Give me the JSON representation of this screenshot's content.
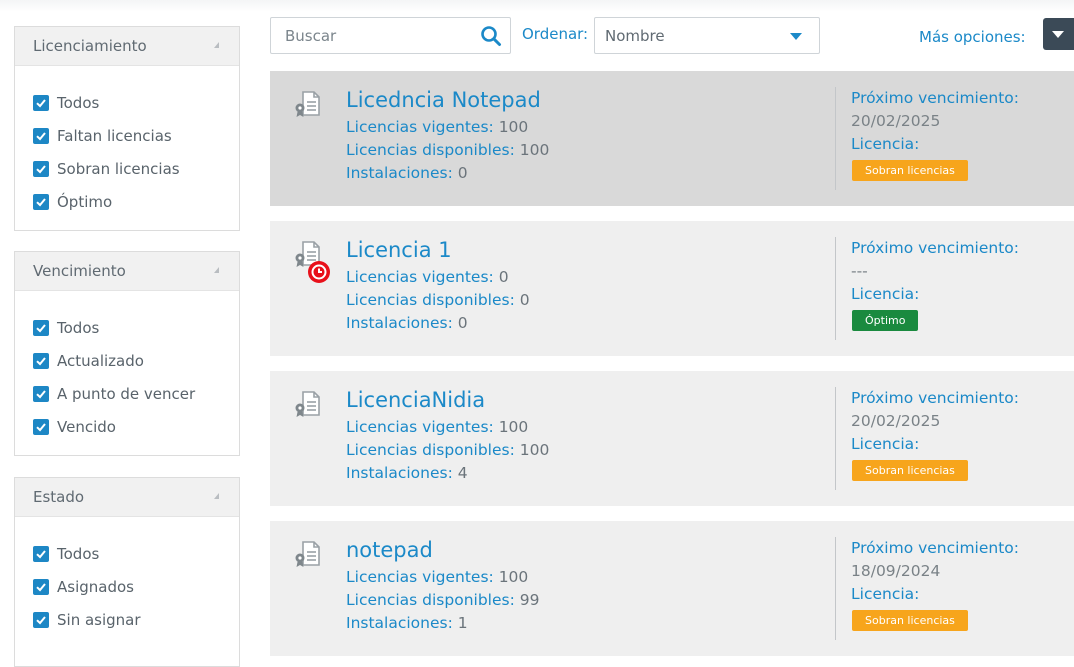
{
  "filters": [
    {
      "title": "Licenciamiento",
      "options": [
        "Todos",
        "Faltan licencias",
        "Sobran licencias",
        "Óptimo"
      ]
    },
    {
      "title": "Vencimiento",
      "options": [
        "Todos",
        "Actualizado",
        "A punto de vencer",
        "Vencido"
      ]
    },
    {
      "title": "Estado",
      "options": [
        "Todos",
        "Asignados",
        "Sin asignar"
      ]
    }
  ],
  "toolbar": {
    "search_placeholder": "Buscar",
    "order_label": "Ordenar:",
    "order_value": "Nombre",
    "more_options_label": "Más opciones:"
  },
  "labels": {
    "vigentes": "Licencias vigentes:",
    "disponibles": "Licencias disponibles:",
    "instalaciones": "Instalaciones:",
    "proximo": "Próximo vencimiento:",
    "licencia": "Licencia:"
  },
  "licenses": [
    {
      "name": "Licedncia Notepad",
      "vigentes": "100",
      "disponibles": "100",
      "instalaciones": "0",
      "vencimiento": "20/02/2025",
      "estado": "Sobran licencias",
      "estado_color": "#f7a51c",
      "selected": true,
      "alert": false
    },
    {
      "name": "Licencia 1",
      "vigentes": "0",
      "disponibles": "0",
      "instalaciones": "0",
      "vencimiento": "---",
      "estado": "Óptimo",
      "estado_color": "#1a8a3f",
      "selected": false,
      "alert": true
    },
    {
      "name": "LicenciaNidia",
      "vigentes": "100",
      "disponibles": "100",
      "instalaciones": "4",
      "vencimiento": "20/02/2025",
      "estado": "Sobran licencias",
      "estado_color": "#f7a51c",
      "selected": false,
      "alert": false
    },
    {
      "name": "notepad",
      "vigentes": "100",
      "disponibles": "99",
      "instalaciones": "1",
      "vencimiento": "18/09/2024",
      "estado": "Sobran licencias",
      "estado_color": "#f7a51c",
      "selected": false,
      "alert": false
    }
  ],
  "colors": {
    "accent": "#1b89c8",
    "checkbox": "#1d87c5",
    "dark_button": "#3b4a57",
    "alert": "#e8101a"
  },
  "icons": {
    "license": "license-document-icon",
    "alert": "clock-alert-icon",
    "search": "search-icon"
  }
}
